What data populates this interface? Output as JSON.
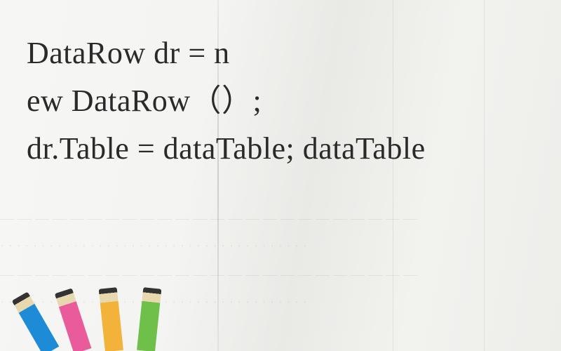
{
  "code": {
    "line1": "DataRow dr = n",
    "line2": "ew DataRow（）;",
    "line3": "dr.Table = dataTable; dataTable"
  },
  "background_hint_lines": [
    "— — — — — — — — — — — — — — — — — — — — — — — —",
    "· · · · · · · · · · · · · · · · · · · · · · · · · · · · · · · · · · · · · ·",
    "— — — — — — — — — — — — — — — — — — — — — — — —",
    "· · · · · · · · · · · · · · · · · · · · · · · · · · · · · · · · · · · · · ·"
  ],
  "pencils": [
    {
      "color": "#1d8bd6"
    },
    {
      "color": "#e95b9a"
    },
    {
      "color": "#f3b23a"
    },
    {
      "color": "#6fbf4b"
    }
  ]
}
